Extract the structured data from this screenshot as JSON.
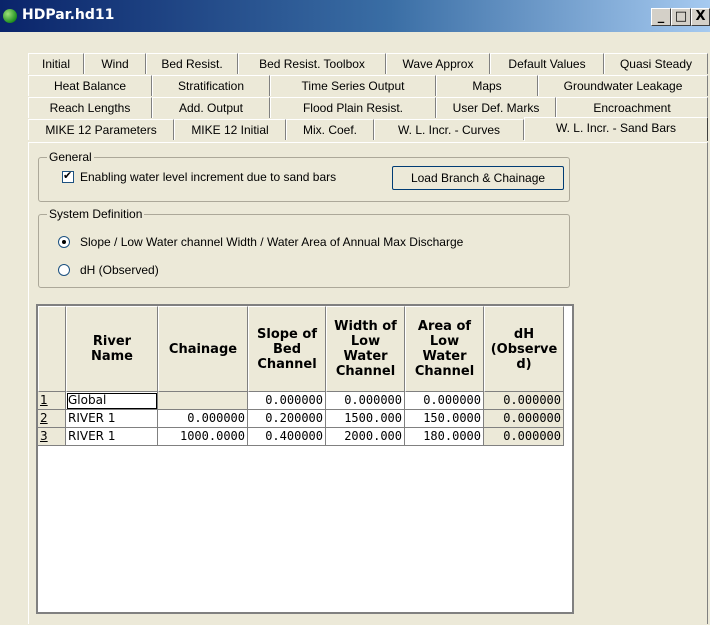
{
  "window": {
    "title": "HDPar.hd11"
  },
  "titlebar_buttons": {
    "minimize": "_",
    "maximize": "□",
    "close": "X"
  },
  "tabs": {
    "row1": [
      "Initial",
      "Wind",
      "Bed Resist.",
      "Bed Resist. Toolbox",
      "Wave Approx",
      "Default Values",
      "Quasi Steady"
    ],
    "row2": [
      "Heat Balance",
      "Stratification",
      "Time Series Output",
      "Maps",
      "Groundwater Leakage"
    ],
    "row3": [
      "Reach Lengths",
      "Add. Output",
      "Flood Plain Resist.",
      "User Def. Marks",
      "Encroachment"
    ],
    "row4": [
      "MIKE 12 Parameters",
      "MIKE 12 Initial",
      "Mix. Coef.",
      "W. L. Incr. - Curves",
      "W. L. Incr. - Sand Bars"
    ],
    "selected": "W. L. Incr. - Sand Bars"
  },
  "general": {
    "legend": "General",
    "checkbox_label": "Enabling water level increment due to sand bars",
    "checkbox_checked": true,
    "button_label": "Load Branch & Chainage"
  },
  "system": {
    "legend": "System Definition",
    "radio1_label": "Slope / Low Water channel Width / Water Area of Annual Max Discharge",
    "radio2_label": "dH (Observed)",
    "selected": "radio1"
  },
  "table": {
    "headers": [
      "River Name",
      "Chainage",
      "Slope of Bed Channel",
      "Width of Low Water Channel",
      "Area of Low Water Channel",
      "dH (Observed)"
    ],
    "headers_display": [
      "River\nName",
      "Chainage",
      "Slope of\nBed\nChannel",
      "Width of\nLow\nWater\nChannel",
      "Area of\nLow\nWater\nChannel",
      "dH\n(Observe\nd)"
    ],
    "rows": [
      {
        "n": "1",
        "river": "Global",
        "chainage": "",
        "slope": "0.000000",
        "width": "0.000000",
        "area": "0.000000",
        "dh": "0.000000"
      },
      {
        "n": "2",
        "river": "RIVER 1",
        "chainage": "0.000000",
        "slope": "0.200000",
        "width": "1500.000",
        "area": "150.0000",
        "dh": "0.000000"
      },
      {
        "n": "3",
        "river": "RIVER 1",
        "chainage": "1000.0000",
        "slope": "0.400000",
        "width": "2000.000",
        "area": "180.0000",
        "dh": "0.000000"
      }
    ]
  }
}
